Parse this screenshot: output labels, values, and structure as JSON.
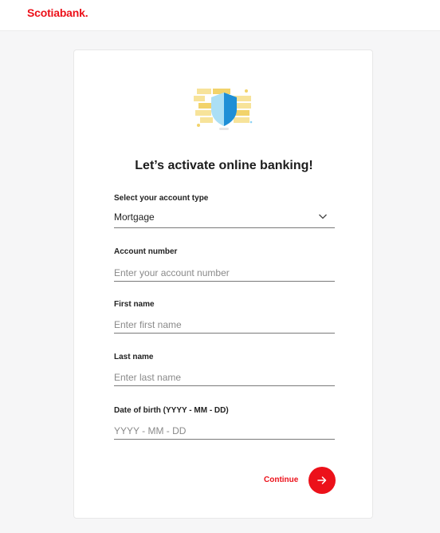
{
  "header": {
    "brand": "Scotiabank.",
    "brand_color": "#ec111a"
  },
  "card": {
    "illustration": "shield-icon",
    "title": "Let’s activate online banking!"
  },
  "form": {
    "account_type": {
      "label": "Select your account type",
      "value": "Mortgage",
      "icon": "chevron-down-icon"
    },
    "account_number": {
      "label": "Account number",
      "placeholder": "Enter your account number"
    },
    "first_name": {
      "label": "First name",
      "placeholder": "Enter first name"
    },
    "last_name": {
      "label": "Last name",
      "placeholder": "Enter last name"
    },
    "date_of_birth": {
      "label": "Date of birth (YYYY - MM - DD)",
      "placeholder": "YYYY - MM - DD"
    }
  },
  "actions": {
    "continue_label": "Continue",
    "continue_icon": "arrow-right-icon",
    "accent_color": "#ec111a"
  }
}
